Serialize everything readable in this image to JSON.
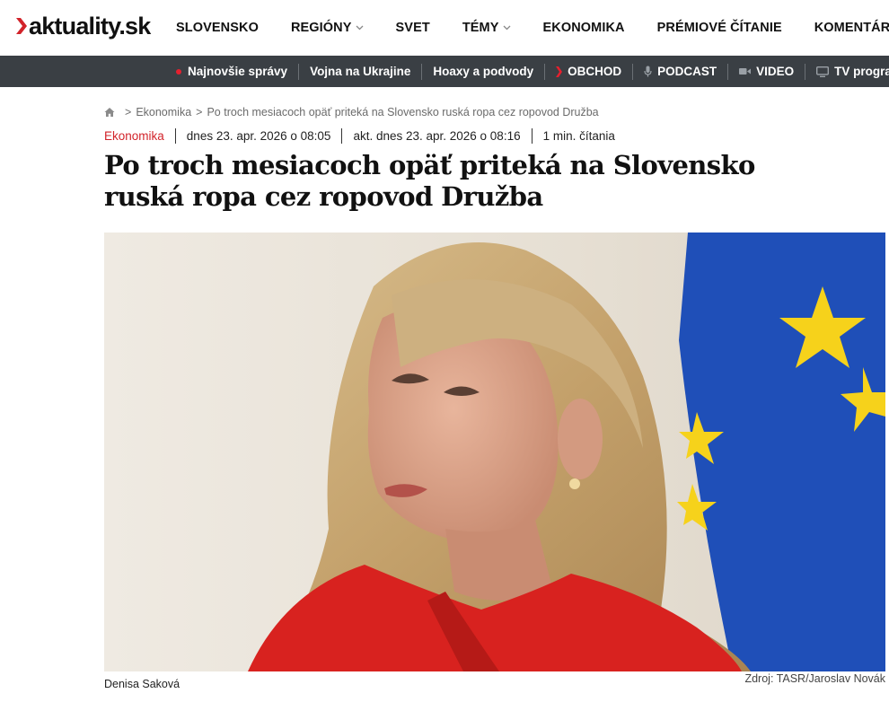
{
  "header": {
    "logo_text": "aktuality.sk",
    "nav": [
      {
        "label": "SLOVENSKO",
        "has_dropdown": false
      },
      {
        "label": "REGIÓNY",
        "has_dropdown": true
      },
      {
        "label": "SVET",
        "has_dropdown": false
      },
      {
        "label": "TÉMY",
        "has_dropdown": true
      },
      {
        "label": "EKONOMIKA",
        "has_dropdown": false
      },
      {
        "label": "PRÉMIOVÉ ČÍTANIE",
        "has_dropdown": false
      },
      {
        "label": "KOMENTÁRE",
        "has_dropdown": false
      }
    ]
  },
  "subnav": {
    "items": [
      {
        "label": "Najnovšie správy",
        "icon": "red-dot-icon"
      },
      {
        "label": "Vojna na Ukrajine",
        "icon": ""
      },
      {
        "label": "Hoaxy a podvody",
        "icon": ""
      },
      {
        "label": "OBCHOD",
        "icon": "chevron-right-icon"
      },
      {
        "label": "PODCAST",
        "icon": "microphone-icon"
      },
      {
        "label": "VIDEO",
        "icon": "video-camera-icon"
      },
      {
        "label": "TV program",
        "icon": "tv-icon"
      }
    ]
  },
  "breadcrumb": {
    "home_icon": "home-icon",
    "items": [
      "Ekonomika",
      "Po troch mesiacoch opäť priteká na Slovensko ruská ropa cez ropovod Družba"
    ]
  },
  "article": {
    "category": "Ekonomika",
    "published": "dnes 23. apr. 2026 o 08:05",
    "updated": "akt. dnes 23. apr. 2026 o 08:16",
    "reading_time": "1 min. čítania",
    "title": "Po troch mesiacoch opäť priteká na Slovensko ruská ropa cez ropovod Družba",
    "photo_caption": "Denisa Saková",
    "photo_credit": "Zdroj: TASR/Jaroslav Novák"
  },
  "colors": {
    "brand_red": "#d2232a",
    "subnav_bg": "#3a3f44",
    "eu_blue": "#1f4fb8",
    "eu_yellow": "#f6d21b"
  }
}
